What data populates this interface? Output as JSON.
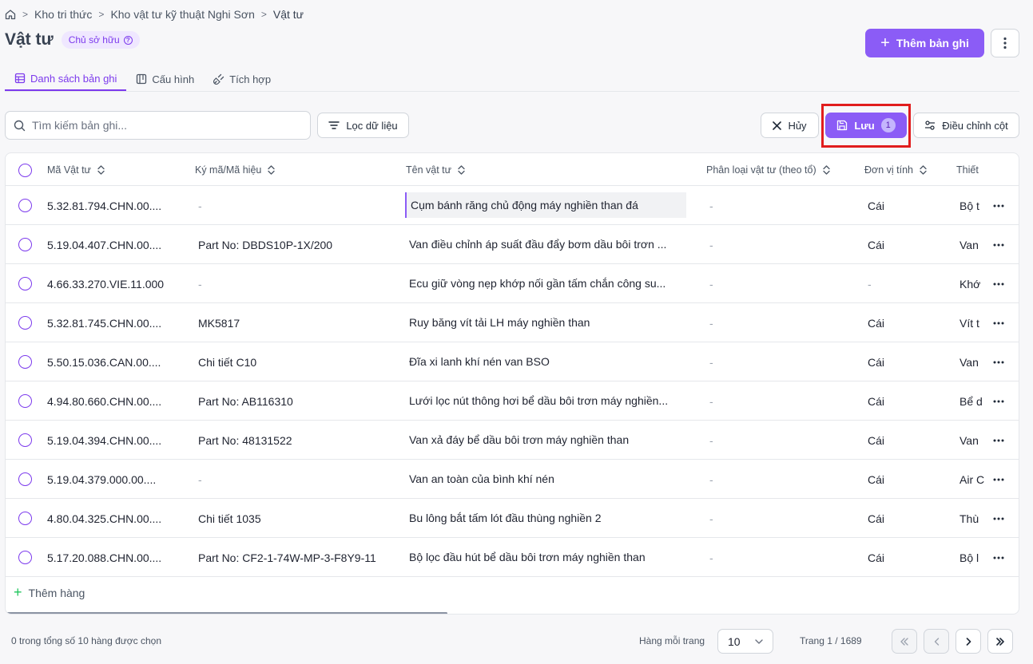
{
  "breadcrumb": {
    "items": [
      "Kho tri thức",
      "Kho vật tư kỹ thuật Nghi Sơn",
      "Vật tư"
    ]
  },
  "header": {
    "title": "Vật tư",
    "owner_badge": "Chủ sở hữu",
    "add_button": "Thêm bản ghi"
  },
  "tabs": [
    {
      "label": "Danh sách bản ghi",
      "active": true
    },
    {
      "label": "Cấu hình"
    },
    {
      "label": "Tích hợp"
    }
  ],
  "toolbar": {
    "search_placeholder": "Tìm kiếm bản ghi...",
    "filter_label": "Lọc dữ liệu",
    "cancel_label": "Hủy",
    "save_label": "Lưu",
    "save_count": "1",
    "columns_label": "Điều chỉnh cột"
  },
  "table": {
    "headers": [
      "Mã Vật tư",
      "Ký mã/Mã hiệu",
      "Tên vật tư",
      "Phân loại vật tư (theo tổ)",
      "Đơn vị tính",
      "Thiết"
    ],
    "rows": [
      [
        "5.32.81.794.CHN.00....",
        "-",
        "Cụm bánh răng chủ động máy nghiền than đá",
        "-",
        "Cái",
        "Bộ t"
      ],
      [
        "5.19.04.407.CHN.00....",
        "Part No: DBDS10P-1X/200",
        "Van điều chỉnh áp suất đầu đẩy bơm dầu bôi trơn ...",
        "-",
        "Cái",
        "Van"
      ],
      [
        "4.66.33.270.VIE.11.000",
        "-",
        "Ecu giữ vòng nẹp khớp nối gần tấm chắn công su...",
        "-",
        "-",
        "Khớ"
      ],
      [
        "5.32.81.745.CHN.00....",
        "MK5817",
        "Ruy băng vít tải LH máy nghiền than",
        "-",
        "Cái",
        "Vít t"
      ],
      [
        "5.50.15.036.CAN.00....",
        "Chi tiết C10",
        "Đĩa xi lanh khí nén van BSO",
        "-",
        "Cái",
        "Van"
      ],
      [
        "4.94.80.660.CHN.00....",
        "Part No: AB116310",
        "Lưới lọc nút thông hơi bể dầu bôi trơn máy nghiền...",
        "-",
        "Cái",
        "Bể d"
      ],
      [
        "5.19.04.394.CHN.00....",
        "Part No: 48131522",
        "Van xả đáy bể dầu bôi trơn máy nghiền than",
        "-",
        "Cái",
        "Van"
      ],
      [
        "5.19.04.379.000.00....",
        "-",
        "Van an toàn của bình khí nén",
        "-",
        "Cái",
        "Air C"
      ],
      [
        "4.80.04.325.CHN.00....",
        "Chi tiết 1035",
        "Bu lông bắt tấm lót đầu thùng nghiền 2",
        "-",
        "Cái",
        "Thù"
      ],
      [
        "5.17.20.088.CHN.00....",
        "Part No: CF2-1-74W-MP-3-F8Y9-11",
        "Bộ lọc đầu hút bể dầu bôi trơn máy nghiền than",
        "-",
        "Cái",
        "Bộ l"
      ]
    ],
    "add_row_label": "Thêm hàng"
  },
  "footer": {
    "selection": "0 trong tổng số 10 hàng được chọn",
    "per_page_label": "Hàng mỗi trang",
    "per_page_value": "10",
    "page_info": "Trang 1 / 1689"
  },
  "colors": {
    "accent": "#8b5cf6",
    "highlight": "#e11d1d",
    "plus_green": "#22c55e"
  },
  "icons": [
    "home-icon",
    "plus-icon",
    "more-vertical-icon",
    "table-icon",
    "config-icon",
    "integration-icon",
    "search-icon",
    "filter-icon",
    "close-icon",
    "save-icon",
    "columns-icon",
    "sort-icon",
    "chevron-down-icon",
    "chevrons-left-icon",
    "chevron-left-icon",
    "chevron-right-icon",
    "chevrons-right-icon"
  ]
}
